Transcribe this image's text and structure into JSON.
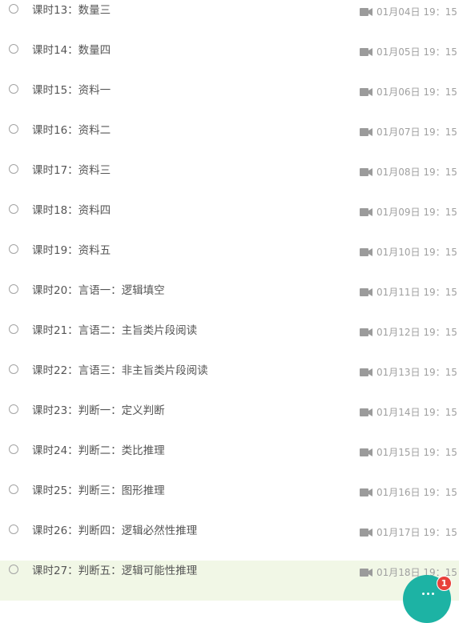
{
  "lessons": [
    {
      "title": "课时13：数量三",
      "time": "01月04日 19：15",
      "active": false
    },
    {
      "title": "课时14：数量四",
      "time": "01月05日 19：15",
      "active": false
    },
    {
      "title": "课时15：资料一",
      "time": "01月06日 19：15",
      "active": false
    },
    {
      "title": "课时16：资料二",
      "time": "01月07日 19：15",
      "active": false
    },
    {
      "title": "课时17：资料三",
      "time": "01月08日 19：15",
      "active": false
    },
    {
      "title": "课时18：资料四",
      "time": "01月09日 19：15",
      "active": false
    },
    {
      "title": "课时19：资料五",
      "time": "01月10日 19：15",
      "active": false
    },
    {
      "title": "课时20：言语一：逻辑填空",
      "time": "01月11日 19：15",
      "active": false
    },
    {
      "title": "课时21：言语二：主旨类片段阅读",
      "time": "01月12日 19：15",
      "active": false
    },
    {
      "title": "课时22：言语三：非主旨类片段阅读",
      "time": "01月13日 19：15",
      "active": false
    },
    {
      "title": "课时23：判断一：定义判断",
      "time": "01月14日 19：15",
      "active": false
    },
    {
      "title": "课时24：判断二：类比推理",
      "time": "01月15日 19：15",
      "active": false
    },
    {
      "title": "课时25：判断三：图形推理",
      "time": "01月16日 19：15",
      "active": false
    },
    {
      "title": "课时26：判断四：逻辑必然性推理",
      "time": "01月17日 19：15",
      "active": false
    },
    {
      "title": "课时27：判断五：逻辑可能性推理",
      "time": "01月18日 19：15",
      "active": true
    }
  ],
  "icons": {
    "status": "radio-circle-icon",
    "video": "video-camera-icon",
    "chat": "chat-bubble-icon"
  },
  "chat": {
    "badge_count": "1"
  },
  "colors": {
    "active_row": "#f1f7e6",
    "title_text": "#555555",
    "time_text": "#a0a0a0",
    "chat_accent": "#1db3a4",
    "badge": "#e8413b"
  }
}
